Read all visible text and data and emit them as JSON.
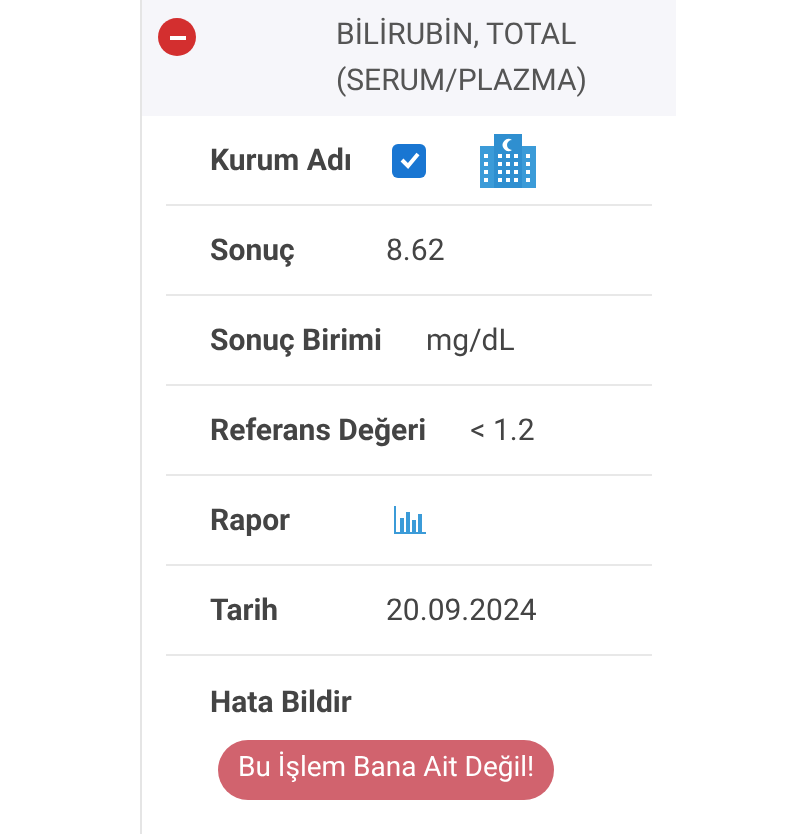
{
  "test": {
    "title": "BİLİRUBİN, TOTAL (SERUM/PLAZMA)",
    "expanded": true,
    "rows": [
      {
        "kind": "institution",
        "label": "Kurum Adı",
        "checked": true
      },
      {
        "kind": "text",
        "label": "Sonuç",
        "value": "8.62"
      },
      {
        "kind": "text",
        "label": "Sonuç Birimi",
        "value": "mg/dL"
      },
      {
        "kind": "text",
        "label": "Referans Değeri",
        "value": "< 1.2"
      },
      {
        "kind": "report",
        "label": "Rapor"
      },
      {
        "kind": "text",
        "label": "Tarih",
        "value": "20.09.2024"
      }
    ],
    "report_error": {
      "label": "Hata Bildir",
      "button": "Bu İşlem Bana Ait Değil!"
    }
  }
}
